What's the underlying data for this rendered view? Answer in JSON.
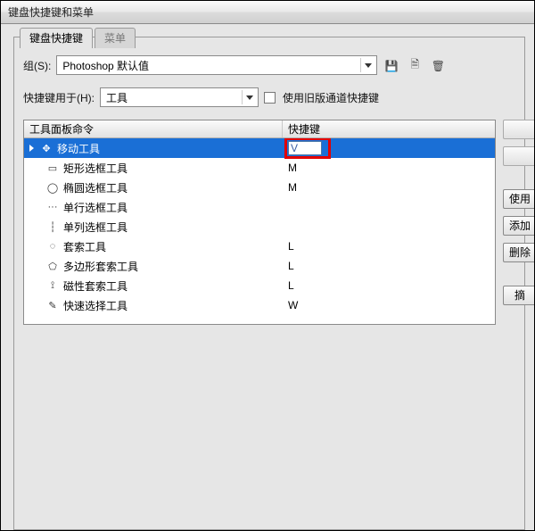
{
  "window": {
    "title": "键盘快捷键和菜单"
  },
  "tabs": {
    "shortcuts": "键盘快捷键",
    "menus": "菜单"
  },
  "group": {
    "label": "组(S):",
    "value": "Photoshop 默认值"
  },
  "icons": {
    "save": "save-icon",
    "save_as": "save-as-icon",
    "delete": "delete-icon"
  },
  "shortcuts_for": {
    "label": "快捷键用于(H):",
    "value": "工具"
  },
  "legacy_checkbox": "使用旧版通道快捷键",
  "table": {
    "col_command": "工具面板命令",
    "col_shortcut": "快捷键",
    "rows": [
      {
        "name": "移动工具",
        "shortcut": "V",
        "icon": "move-icon",
        "selected": true,
        "editing": true
      },
      {
        "name": "矩形选框工具",
        "shortcut": "M",
        "icon": "rect-marquee-icon"
      },
      {
        "name": "椭圆选框工具",
        "shortcut": "M",
        "icon": "ellipse-marquee-icon"
      },
      {
        "name": "单行选框工具",
        "shortcut": "",
        "icon": "row-marquee-icon"
      },
      {
        "name": "单列选框工具",
        "shortcut": "",
        "icon": "col-marquee-icon"
      },
      {
        "name": "套索工具",
        "shortcut": "L",
        "icon": "lasso-icon"
      },
      {
        "name": "多边形套索工具",
        "shortcut": "L",
        "icon": "poly-lasso-icon"
      },
      {
        "name": "磁性套索工具",
        "shortcut": "L",
        "icon": "magnetic-lasso-icon"
      },
      {
        "name": "快速选择工具",
        "shortcut": "W",
        "icon": "quick-select-icon"
      }
    ]
  },
  "side": {
    "blank1": "",
    "blank2": "",
    "use_default": "使用",
    "add": "添加",
    "delete": "删除",
    "summary": "摘"
  }
}
